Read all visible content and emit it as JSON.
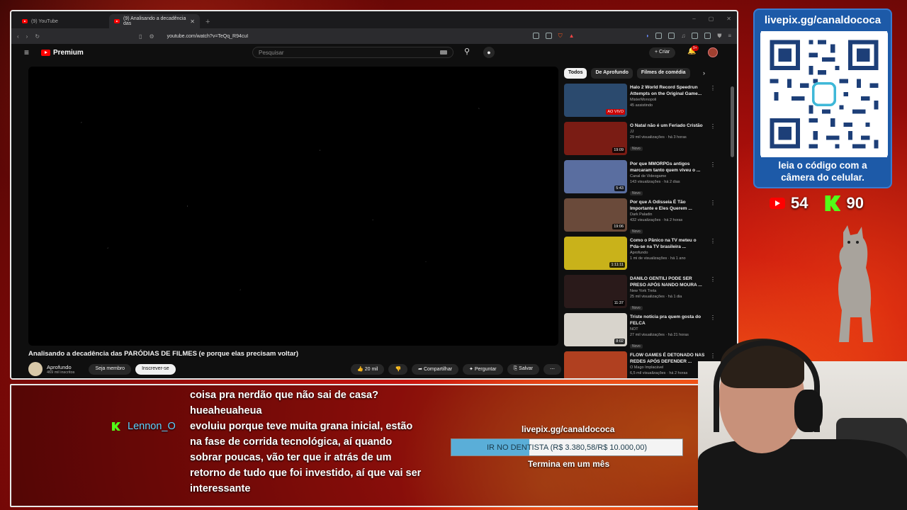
{
  "browser": {
    "tabs": [
      {
        "title": "(9) YouTube",
        "active": false
      },
      {
        "title": "(9) Analisando a decadência das",
        "active": true
      }
    ],
    "url": "youtube.com/watch?v=TeQq_R94cuI"
  },
  "youtube": {
    "logo_text": "Premium",
    "search_placeholder": "Pesquisar",
    "create_label": "Criar",
    "notif_count": "9+",
    "video_title": "Analisando a decadência das PARÓDIAS DE FILMES (e porque elas precisam voltar)",
    "channel_name": "Aprofundo",
    "channel_subs": "469 mil inscritos",
    "join_label": "Seja membro",
    "subscribe_label": "Inscrever-se",
    "likes": "20 mil",
    "share_label": "Compartilhar",
    "ask_label": "Perguntar",
    "save_label": "Salvar",
    "chips": [
      "Todos",
      "De Aprofundo",
      "Filmes de comédia"
    ],
    "recommendations": [
      {
        "title": "Halo 2 World Record Speedrun Attempts on the Original Game...",
        "channel": "MisterMonopoli",
        "meta": "45 assistindo",
        "badge": "",
        "duration": "AO VIVO",
        "live": true,
        "thumb_color": "#2b4a6e"
      },
      {
        "title": "O Natal não é um Feriado Cristão",
        "channel": "JJ",
        "meta": "29 mil visualizações · há 3 horas",
        "badge": "Novo",
        "duration": "19:09",
        "live": false,
        "thumb_color": "#7a1c14"
      },
      {
        "title": "Por que MMORPGs antigos marcaram tanto quem viveu o ...",
        "channel": "Canal de Videogame",
        "meta": "143 visualizações · há 2 dias",
        "badge": "Novo",
        "duration": "5:43",
        "live": false,
        "thumb_color": "#5a6ea0"
      },
      {
        "title": "Por que A Odisseia É Tão Importante e Eles Querem ...",
        "channel": "Dark Paladin",
        "meta": "432 visualizações · há 2 horas",
        "badge": "Novo",
        "duration": "19:06",
        "live": false,
        "thumb_color": "#6a4a3a"
      },
      {
        "title": "Como o Pânico na TV meteu o f*da-se na TV brasileira ...",
        "channel": "Aprofundo",
        "meta": "1 mi de visualizações · há 1 ano",
        "badge": "",
        "duration": "1:11:11",
        "live": false,
        "thumb_color": "#c9b21a"
      },
      {
        "title": "DANILO GENTILI PODE SER PRESO APÓS NANDO MOURA ...",
        "channel": "New York Treta",
        "meta": "25 mil visualizações · há 1 dia",
        "badge": "Novo",
        "duration": "11:37",
        "live": false,
        "thumb_color": "#2a1a1a"
      },
      {
        "title": "Triste notícia pra quem gosta do FELCA",
        "channel": "NOT",
        "meta": "27 mil visualizações · há 21 horas",
        "badge": "Novo",
        "duration": "8:02",
        "live": false,
        "thumb_color": "#d8d4cc"
      },
      {
        "title": "FLOW GAMES É DETONADO NAS REDES APÓS DEFENDER ...",
        "channel": "O Mago Implacável",
        "meta": "6,5 mil visualizações · há 2 horas",
        "badge": "",
        "duration": "",
        "live": false,
        "thumb_color": "#b04020"
      }
    ]
  },
  "chat": {
    "line_prev_1": "coisa pra nerdão que não sai de casa?",
    "line_prev_2": "hueaheuaheua",
    "user": "Lennon_O",
    "lines": [
      "evoluiu porque teve muita grana inicial, estão",
      "na fase de corrida tecnológica, aí quando",
      "sobrar poucas, vão ter que ir atrás de um",
      "retorno de tudo que foi investido, aí que vai ser",
      "interessante"
    ]
  },
  "goal": {
    "url": "livepix.gg/canaldococa",
    "text": "IR NO DENTISTA (R$ 3.380,58/R$ 10.000,00)",
    "progress": 0.338,
    "footer": "Termina em um mês"
  },
  "qr_panel": {
    "title": "livepix.gg/canaldococa",
    "caption_1": "leia o código com a",
    "caption_2": "câmera do celular."
  },
  "counters": {
    "youtube": "54",
    "kick": "90"
  },
  "colors": {
    "accent_red": "#ff0000",
    "kick_green": "#53fc18",
    "goal_blue": "#5aaed8",
    "qr_blue": "#1d5aa8"
  }
}
